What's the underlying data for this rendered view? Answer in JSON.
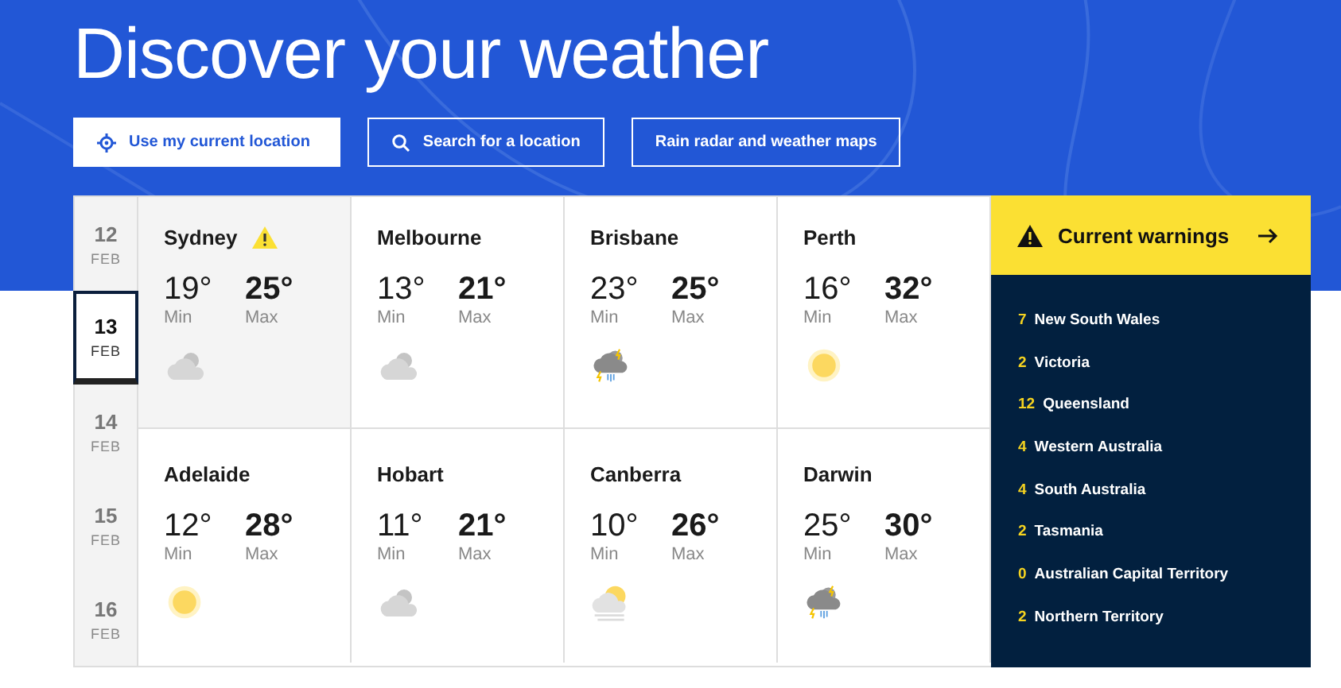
{
  "hero": {
    "title": "Discover your weather",
    "buttons": [
      {
        "label": "Use my current location",
        "kind": "locate"
      },
      {
        "label": "Search for a location",
        "kind": "search"
      },
      {
        "label": "Rain radar and weather maps",
        "kind": "plain"
      }
    ]
  },
  "dates": [
    {
      "day": "12",
      "month": "FEB",
      "selected": false
    },
    {
      "day": "13",
      "month": "FEB",
      "selected": true
    },
    {
      "day": "14",
      "month": "FEB",
      "selected": false
    },
    {
      "day": "15",
      "month": "FEB",
      "selected": false
    },
    {
      "day": "16",
      "month": "FEB",
      "selected": false
    }
  ],
  "cities": [
    {
      "name": "Sydney",
      "warning": true,
      "highlighted": true,
      "min": "19°",
      "min_label": "Min",
      "max": "25°",
      "max_label": "Max",
      "kind": "cloudy"
    },
    {
      "name": "Melbourne",
      "warning": false,
      "highlighted": false,
      "min": "13°",
      "min_label": "Min",
      "max": "21°",
      "max_label": "Max",
      "kind": "cloudy"
    },
    {
      "name": "Brisbane",
      "warning": false,
      "highlighted": false,
      "min": "23°",
      "min_label": "Min",
      "max": "25°",
      "max_label": "Max",
      "kind": "storm"
    },
    {
      "name": "Perth",
      "warning": false,
      "highlighted": false,
      "min": "16°",
      "min_label": "Min",
      "max": "32°",
      "max_label": "Max",
      "kind": "sunny"
    },
    {
      "name": "Adelaide",
      "warning": false,
      "highlighted": false,
      "min": "12°",
      "min_label": "Min",
      "max": "28°",
      "max_label": "Max",
      "kind": "sunny"
    },
    {
      "name": "Hobart",
      "warning": false,
      "highlighted": false,
      "min": "11°",
      "min_label": "Min",
      "max": "21°",
      "max_label": "Max",
      "kind": "cloudy"
    },
    {
      "name": "Canberra",
      "warning": false,
      "highlighted": false,
      "min": "10°",
      "min_label": "Min",
      "max": "26°",
      "max_label": "Max",
      "kind": "fog-sun"
    },
    {
      "name": "Darwin",
      "warning": false,
      "highlighted": false,
      "min": "25°",
      "min_label": "Min",
      "max": "30°",
      "max_label": "Max",
      "kind": "storm"
    }
  ],
  "warnings": {
    "title": "Current warnings",
    "items": [
      {
        "count": "7",
        "region": "New South Wales"
      },
      {
        "count": "2",
        "region": "Victoria"
      },
      {
        "count": "12",
        "region": "Queensland"
      },
      {
        "count": "4",
        "region": "Western Australia"
      },
      {
        "count": "4",
        "region": "South Australia"
      },
      {
        "count": "2",
        "region": "Tasmania"
      },
      {
        "count": "0",
        "region": "Australian Capital Territory"
      },
      {
        "count": "2",
        "region": "Northern Territory"
      }
    ]
  }
}
